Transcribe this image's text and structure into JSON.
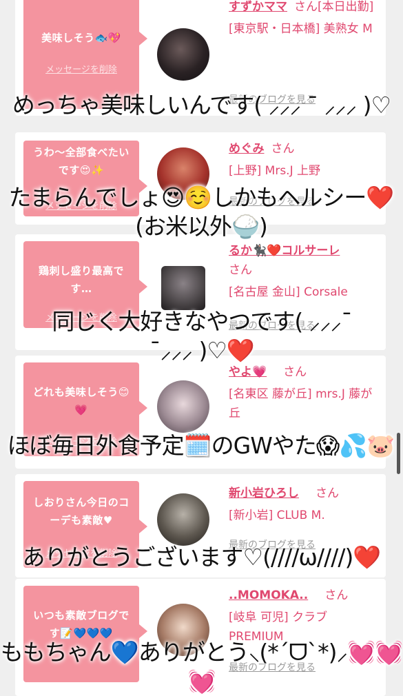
{
  "cards": [
    {
      "bubble": "美味しそう🐟💖",
      "delete_label": "メッセージを削除",
      "name": "すずかママ",
      "san": "さん[本日出勤]",
      "store": "[東京駅・日本橋] 美熟女 M",
      "blog": "最新のブログを見る"
    },
    {
      "bubble": "うわ〜全部食べたいです😍✨",
      "delete_label": "メッセージを削除",
      "name": "めぐみ",
      "san": "さん",
      "store": "[上野] Mrs.J 上野",
      "blog": "最新のブログを見る"
    },
    {
      "bubble": "鶏刺し盛り最高です…",
      "delete_label": "メッセージを削除",
      "name": "るか🐈‍⬛❤️コルサーレ",
      "san": "さん",
      "store": "[名古屋 金山] Corsale",
      "blog": "最新のブログを見る"
    },
    {
      "bubble": "どれも美味しそう😊💗",
      "delete_label": "メッセージを削除",
      "name": "やよ💗",
      "san": "さん",
      "store": "[名東区 藤が丘] mrs.J 藤が丘",
      "blog": ""
    },
    {
      "bubble": "しおりさん今日のコーデも素敵♥",
      "delete_label": "メッセージを削除",
      "name": "新小岩ひろし",
      "san": "さん",
      "store": "[新小岩] CLUB M.",
      "blog": "最新のブログを見る"
    },
    {
      "bubble": "いつも素敵ブログです📝💙💙💙",
      "delete_label": "",
      "name": "..MOMOKA..",
      "san": "さん",
      "store": "[岐阜 可児] クラブ PREMIUM",
      "blog": "最新のブログを見る"
    }
  ],
  "overlay_comments": [
    "めっちゃ美味しいんです( ⸝⸝⸝ ¯ ⸝⸝⸝ )♡",
    "たまらんでしょ😍☺️しかもヘルシー❤️(お米以外🍚)",
    "同じく大好きなやつです( ⸝⸝⸝¯ ¯⸝⸝⸝ )♡❤️",
    "ほぼ毎日外食予定🗓️のGWやた😱💦🐷",
    "ありがとうございます♡(////ω////)❤️",
    "ももちゃん💙ありがとう⸜(*´ᗜ`*)⸝💓💓💓"
  ],
  "colors": {
    "bubble": "#f4949f",
    "name": "#e0486f",
    "background": "#efefef"
  }
}
